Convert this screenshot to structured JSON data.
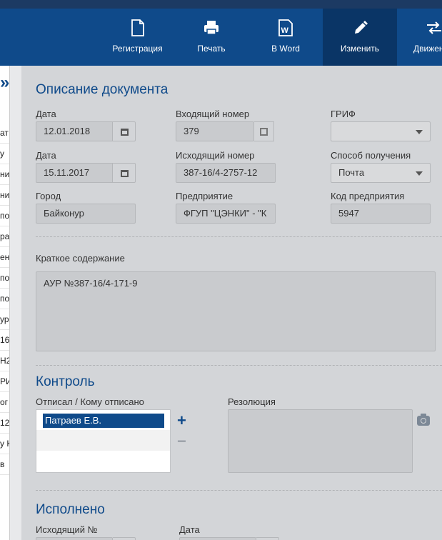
{
  "toolbar": {
    "buttons": [
      {
        "label": "Регистрация",
        "icon": "file-icon"
      },
      {
        "label": "Печать",
        "icon": "printer-icon"
      },
      {
        "label": "В Word",
        "icon": "word-icon"
      },
      {
        "label": "Изменить",
        "icon": "pencil-icon"
      },
      {
        "label": "Движен",
        "icon": "arrows-icon"
      }
    ]
  },
  "left_list": {
    "rows": [
      "ат",
      "у",
      "ни",
      "ни",
      "по",
      "ра",
      "ен",
      "по",
      "по",
      "ур",
      "16",
      "Н2",
      "РИ",
      "ог",
      "12",
      "у К",
      "в"
    ]
  },
  "description": {
    "title": "Описание документа",
    "date1_label": "Дата",
    "date1_value": "12.01.2018",
    "incoming_label": "Входящий номер",
    "incoming_value": "379",
    "grif_label": "ГРИФ",
    "grif_value": "",
    "date2_label": "Дата",
    "date2_value": "15.11.2017",
    "outgoing_label": "Исходящий номер",
    "outgoing_value": "387-16/4-2757-12",
    "method_label": "Способ получения",
    "method_value": "Почта",
    "city_label": "Город",
    "city_value": "Байконур",
    "enterprise_label": "Предприятие",
    "enterprise_value": "ФГУП \"ЦЭНКИ\" - \"К",
    "code_label": "Код предприятия",
    "code_value": "5947",
    "summary_label": "Краткое содержание",
    "summary_value": "АУР №387-16/4-171-9"
  },
  "control": {
    "title": "Контроль",
    "assigned_label": "Отписал / Кому отписано",
    "assigned_items": [
      "Патраев Е.В."
    ],
    "resolution_label": "Резолюция",
    "resolution_value": ""
  },
  "done": {
    "title": "Исполнено",
    "outgoing_label": "Исходящий №",
    "date_label": "Дата"
  },
  "colors": {
    "toolbar": "#0f4a8a",
    "toolbar_active": "#0a3566",
    "accent": "#0f4a8a",
    "background": "#d3d5d8"
  }
}
